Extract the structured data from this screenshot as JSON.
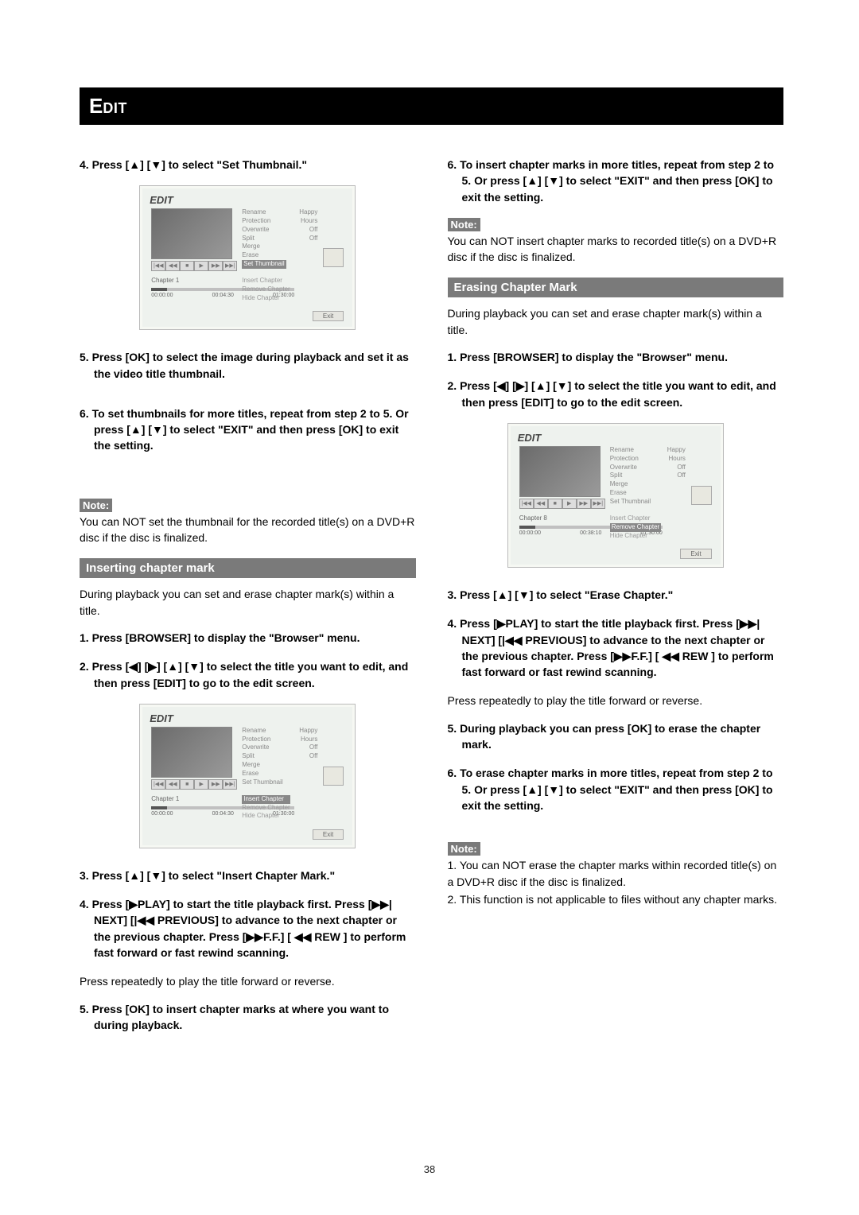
{
  "header": {
    "big": "E",
    "small": "DIT"
  },
  "footer": {
    "page": "38"
  },
  "left": {
    "s4": "4. Press [▲] [▼] to select \"Set Thumbnail.\"",
    "s5": "5. Press [OK] to select the image during playback and set it as the video title thumbnail.",
    "s6": "6. To set thumbnails for more titles, repeat from step 2 to 5. Or press [▲]  [▼] to select \"EXIT\" and then press [OK] to exit the setting.",
    "noteLabel": "Note:",
    "noteText": "You can NOT set the thumbnail for the recorded title(s) on a DVD+R disc if the disc is finalized.",
    "section": "Inserting chapter mark",
    "intro": "During playback you can set and erase chapter mark(s) within a title.",
    "i1": "1. Press [BROWSER] to display the \"Browser\" menu.",
    "i2": "2. Press [◀] [▶] [▲] [▼] to select the title you want to edit, and then press [EDIT] to go to the edit screen.",
    "i3": "3. Press [▲] [▼] to select \"Insert Chapter Mark.\"",
    "i4": "4. Press [▶PLAY] to start the title playback first. Press [▶▶| NEXT] [|◀◀ PREVIOUS] to advance to the next chapter or the previous chapter. Press [▶▶F.F.] [ ◀◀ REW ] to perform fast forward or fast rewind scanning.",
    "i4after": "Press repeatedly to play the title forward or reverse.",
    "i5": "5. Press [OK] to insert chapter marks at where you want to during playback."
  },
  "right": {
    "r6": "6.  To insert chapter marks in more titles, repeat from step 2 to 5. Or press [▲]  [▼] to select \"EXIT\" and then press [OK] to exit the setting.",
    "noteLabel1": "Note:",
    "noteText1": "You can NOT insert chapter marks to recorded title(s) on a DVD+R disc if the disc is finalized.",
    "section": "Erasing Chapter Mark",
    "intro": "During playback you can set and erase chapter mark(s) within a title.",
    "e1": "1. Press [BROWSER] to display the \"Browser\" menu.",
    "e2": "2. Press  [◀] [▶] [▲] [▼] to select the title you want to edit, and then press [EDIT] to go to the edit screen.",
    "e3": "3. Press [▲] [▼] to select \"Erase Chapter.\"",
    "e4": "4. Press [▶PLAY] to start the title playback first. Press [▶▶| NEXT] [|◀◀ PREVIOUS] to advance to the next chapter or the previous chapter. Press [▶▶F.F.] [ ◀◀ REW ] to perform fast forward or fast rewind scanning.",
    "e4after": "Press repeatedly to play the title forward or reverse.",
    "e5": "5. During playback you can press [OK] to erase the chapter mark.",
    "e6": "6. To erase chapter marks in more titles, repeat from step 2 to 5. Or press [▲]  [▼] to select \"EXIT\" and then press [OK] to exit the setting.",
    "noteLabel2": "Note:",
    "noteText2a": "1. You can NOT erase the chapter marks within recorded title(s) on a DVD+R disc if the disc is finalized.",
    "noteText2b": "2. This function is not applicable to files without any chapter marks."
  },
  "shot": {
    "title": "EDIT",
    "menu": {
      "l1": "Rename",
      "l2": "Protection",
      "l3": "Overwrite",
      "l4": "Split",
      "l5": "Merge",
      "l6": "Erase",
      "setthumb": "Set Thumbnail",
      "v1": "Happy Hours",
      "v2": "Off",
      "v3": "Off"
    },
    "bottom": {
      "insert": "Insert Chapter",
      "remove": "Remove Chapter",
      "hide": "Hide Chapter"
    },
    "chapter1": "Chapter 1",
    "chapter8": "Chapter 8",
    "t0": "00:00:00",
    "t1a": "00:04:30",
    "t1b": "00:38:10",
    "t2": "01:30:00",
    "exit": "Exit",
    "tbtn": {
      "b1": "|◀◀",
      "b2": "◀◀",
      "b3": "■",
      "b4": "▶",
      "b5": "▶▶",
      "b6": "▶▶|"
    }
  }
}
